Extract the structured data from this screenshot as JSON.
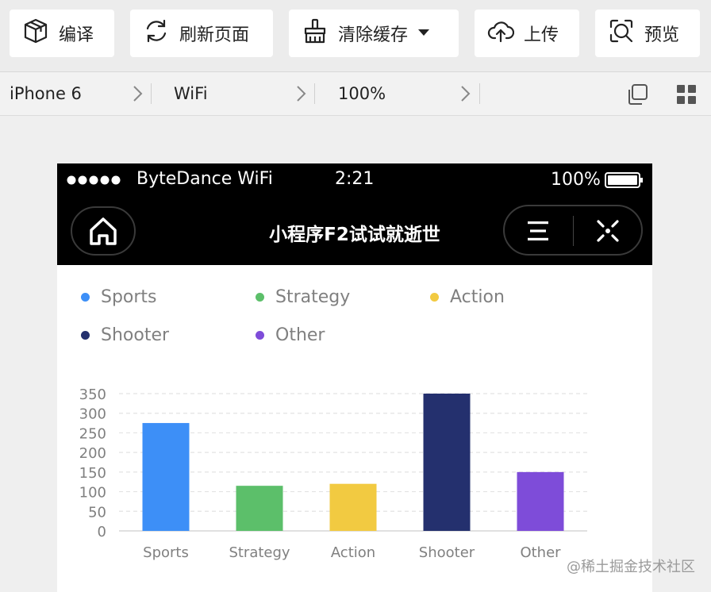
{
  "toolbar": {
    "compile_label": "编译",
    "refresh_label": "刷新页面",
    "clear_cache_label": "清除缓存",
    "upload_label": "上传",
    "preview_label": "预览"
  },
  "device_bar": {
    "device": "iPhone 6",
    "network": "WiFi",
    "zoom": "100%"
  },
  "statusbar": {
    "carrier": "ByteDance WiFi",
    "time": "2:21",
    "battery": "100%"
  },
  "navbar": {
    "title": "小程序F2试试就逝世"
  },
  "legend": [
    {
      "label": "Sports",
      "color": "#3d8ff7"
    },
    {
      "label": "Strategy",
      "color": "#5cbf6a"
    },
    {
      "label": "Action",
      "color": "#f2ca41"
    },
    {
      "label": "Shooter",
      "color": "#24306e"
    },
    {
      "label": "Other",
      "color": "#7e4cd9"
    }
  ],
  "chart_data": {
    "type": "bar",
    "categories": [
      "Sports",
      "Strategy",
      "Action",
      "Shooter",
      "Other"
    ],
    "values": [
      275,
      115,
      120,
      350,
      150
    ],
    "colors": [
      "#3d8ff7",
      "#5cbf6a",
      "#f2ca41",
      "#24306e",
      "#7e4cd9"
    ],
    "yticks": [
      0,
      50,
      100,
      150,
      200,
      250,
      300,
      350
    ],
    "ylim": [
      0,
      350
    ],
    "grid": true,
    "legend_position": "top"
  },
  "watermark": "@稀土掘金技术社区"
}
